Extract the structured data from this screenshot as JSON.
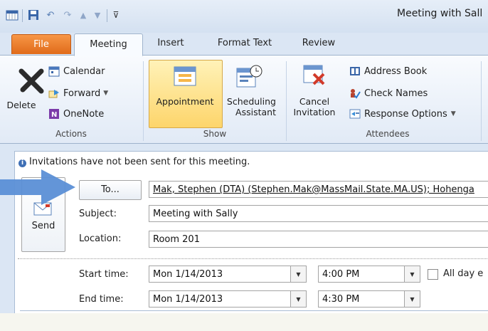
{
  "window": {
    "title": "Meeting with Sall"
  },
  "tabs": [
    "File",
    "Meeting",
    "Insert",
    "Format Text",
    "Review"
  ],
  "ribbon": {
    "actions": {
      "delete": "Delete",
      "calendar": "Calendar",
      "forward": "Forward",
      "onenote": "OneNote",
      "group": "Actions"
    },
    "show": {
      "appointment": "Appointment",
      "scheduling_line1": "Scheduling",
      "scheduling_line2": "Assistant",
      "group": "Show"
    },
    "attendees": {
      "cancel_line1": "Cancel",
      "cancel_line2": "Invitation",
      "address_book": "Address Book",
      "check_names": "Check Names",
      "response_options": "Response Options",
      "group": "Attendees"
    }
  },
  "form": {
    "info": "Invitations have not been sent for this meeting.",
    "send": "Send",
    "to_button": "To...",
    "to_value": "Mak, Stephen (DTA) (Stephen.Mak@MassMail.State.MA.US); Hohenga",
    "subject_label": "Subject:",
    "subject_value": "Meeting with Sally",
    "location_label": "Location:",
    "location_value": "Room 201",
    "start_label": "Start time:",
    "start_date": "Mon 1/14/2013",
    "start_time": "4:00 PM",
    "all_day": "All day e",
    "end_label": "End time:",
    "end_date": "Mon 1/14/2013",
    "end_time": "4:30 PM"
  },
  "colors": {
    "file_tab": "#e06b1a",
    "pointer_arrow": "#5b8fd6",
    "ribbon_bg": "#e1eaf6"
  }
}
